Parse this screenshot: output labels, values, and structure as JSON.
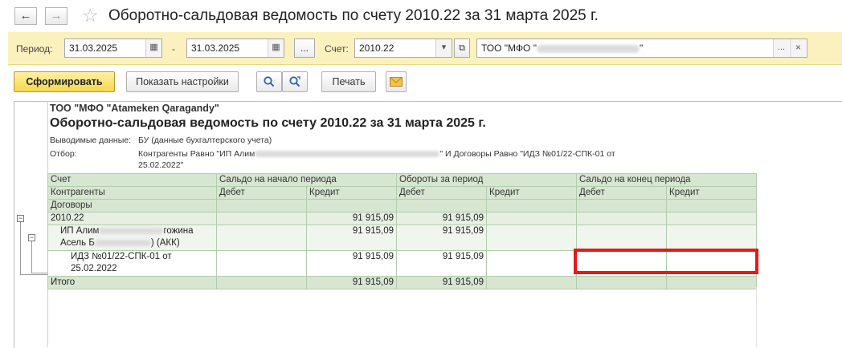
{
  "window": {
    "title": "Оборотно-сальдовая ведомость по счету 2010.22  за 31 марта 2025 г."
  },
  "params": {
    "period_label": "Период:",
    "date_from": "31.03.2025",
    "dash": "-",
    "date_to": "31.03.2025",
    "more_label": "...",
    "account_label": "Счет:",
    "account_value": "2010.22",
    "org_value": "ТОО \"МФО \"",
    "org_value_tail": "\"",
    "clear_label": "×"
  },
  "toolbar": {
    "generate_label": "Сформировать",
    "settings_label": "Показать настройки",
    "print_label": "Печать"
  },
  "report": {
    "org": "ТОО \"МФО \"Atameken Qaragandy\"",
    "heading": "Оборотно-сальдовая ведомость по счету 2010.22  за 31 марта 2025 г.",
    "output_label": "Выводимые данные:",
    "output_value": "БУ (данные бухгалтерского учета)",
    "filter_label": "Отбор:",
    "filter_line1_a": "Контрагенты Равно \"ИП Алим",
    "filter_line1_b": "\" И Договоры Равно \"ИДЗ №01/22-СПК-01  от",
    "filter_line2": "25.02.2022\""
  },
  "table": {
    "h_account": "Счет",
    "h_contr": "Контрагенты",
    "h_contract": "Договоры",
    "h_open": "Сальдо на начало периода",
    "h_turnover": "Обороты за период",
    "h_close": "Сальдо на конец периода",
    "debit": "Дебет",
    "credit": "Кредит",
    "account": "2010.22",
    "account_credit": "91 915,09",
    "account_turn_debit": "91 915,09",
    "contr_line1_a": "ИП Алим",
    "contr_line1_b": "гожина",
    "contr_line2_a": "Асель Б",
    "contr_line2_b": ") (АКК)",
    "contr_credit": "91 915,09",
    "contr_turn_debit": "91 915,09",
    "contract_line1": "ИДЗ №01/22-СПК-01  от",
    "contract_line2": "25.02.2022",
    "contract_credit": "91 915,09",
    "contract_turn_debit": "91 915,09",
    "total": "Итого",
    "total_credit": "91 915,09",
    "total_turn_debit": "91 915,09"
  },
  "icons": {
    "back": "←",
    "forward": "→",
    "star": "☆",
    "calendar": "▦",
    "dropdown": "▾",
    "open": "⧉",
    "expand_minus": "−"
  }
}
